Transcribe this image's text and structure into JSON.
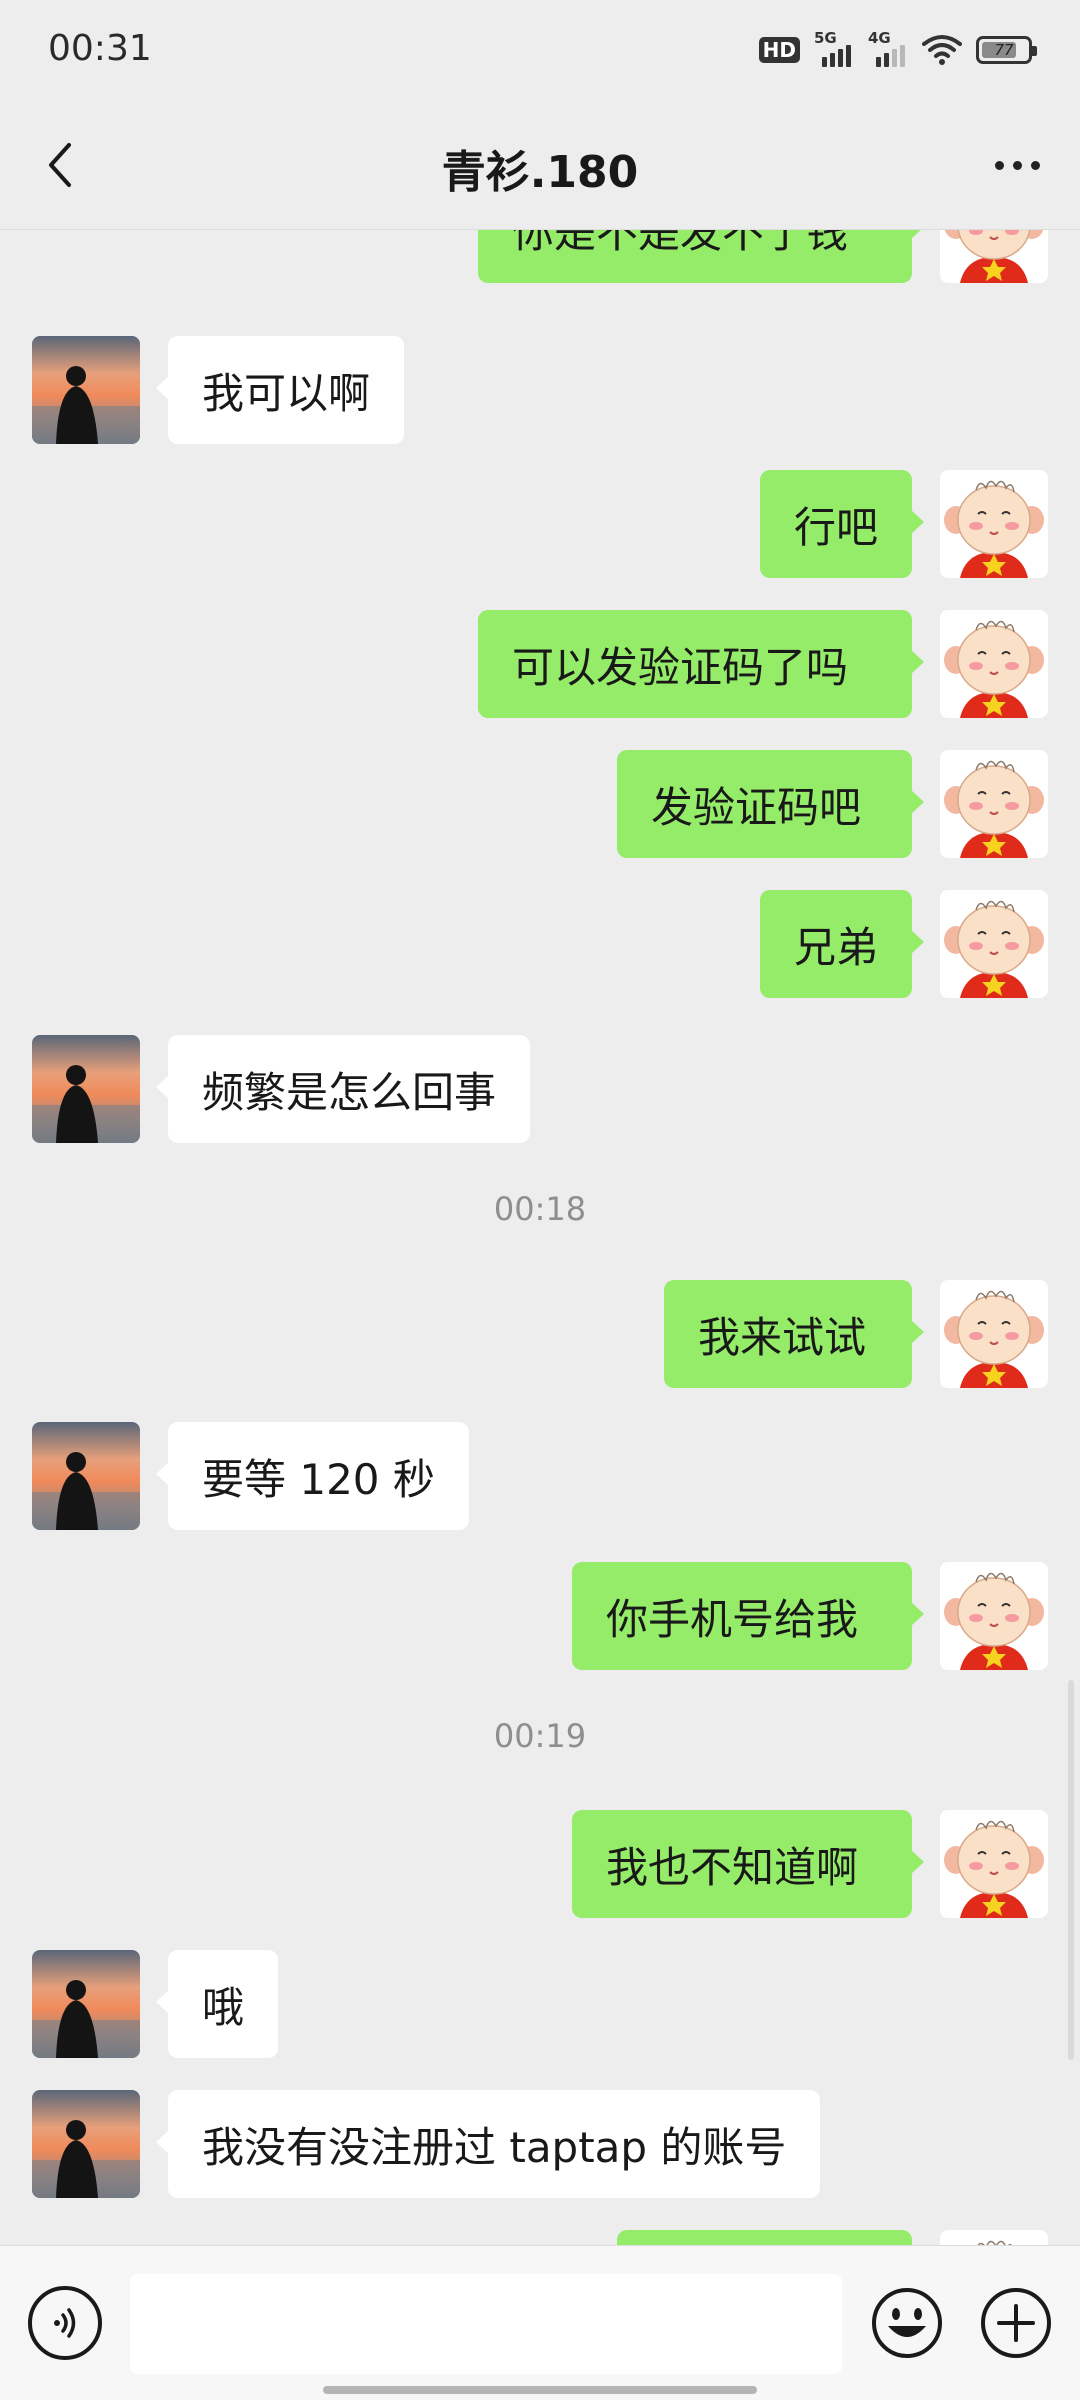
{
  "status_bar": {
    "time": "00:31",
    "hd_label": "HD",
    "net1_label": "5G",
    "net2_label": "4G",
    "battery_level": 77,
    "battery_text": "77"
  },
  "header": {
    "title": "青衫.180",
    "back_icon": "chevron-left-icon",
    "more_icon": "more-dots-icon"
  },
  "colors": {
    "sent_bubble": "#95ec69",
    "received_bubble": "#ffffff",
    "background": "#ededed"
  },
  "messages": [
    {
      "side": "right",
      "text": "你是不是发不了钱"
    },
    {
      "side": "left",
      "text": "我可以啊"
    },
    {
      "side": "right",
      "text": "行吧"
    },
    {
      "side": "right",
      "text": "可以发验证码了吗"
    },
    {
      "side": "right",
      "text": "发验证码吧"
    },
    {
      "side": "right",
      "text": "兄弟"
    },
    {
      "side": "left",
      "text": "频繁是怎么回事"
    },
    {
      "type": "time",
      "text": "00:18"
    },
    {
      "side": "right",
      "text": "我来试试"
    },
    {
      "side": "left",
      "text": "要等 120 秒"
    },
    {
      "side": "right",
      "text": "你手机号给我"
    },
    {
      "type": "time",
      "text": "00:19"
    },
    {
      "side": "right",
      "text": "我也不知道啊"
    },
    {
      "side": "left",
      "text": "哦"
    },
    {
      "side": "left",
      "text": "我没有没注册过 taptap 的账号"
    },
    {
      "side": "right",
      "text": ""
    }
  ],
  "input_bar": {
    "voice_icon": "voice-icon",
    "input_value": "",
    "emoji_icon": "emoji-icon",
    "plus_icon": "plus-icon"
  }
}
